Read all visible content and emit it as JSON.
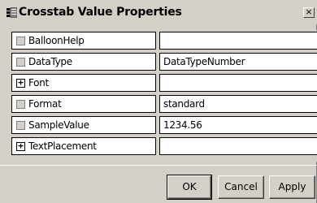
{
  "dialog": {
    "title": "Crosstab Value Properties",
    "close_label": "×"
  },
  "properties": [
    {
      "name": "BalloonHelp",
      "value": "",
      "control": "checkbox"
    },
    {
      "name": "DataType",
      "value": "DataTypeNumber",
      "control": "checkbox"
    },
    {
      "name": "Font",
      "value": "",
      "control": "expander"
    },
    {
      "name": "Format",
      "value": "standard",
      "control": "checkbox"
    },
    {
      "name": "SampleValue",
      "value": "1234.56",
      "control": "checkbox"
    },
    {
      "name": "TextPlacement",
      "value": "",
      "control": "expander"
    }
  ],
  "expander_glyph": "+",
  "buttons": {
    "ok": "OK",
    "cancel": "Cancel",
    "apply": "Apply"
  },
  "colors": {
    "dialog_background": "#d4d0c8",
    "cell_background": "#ffffff"
  }
}
